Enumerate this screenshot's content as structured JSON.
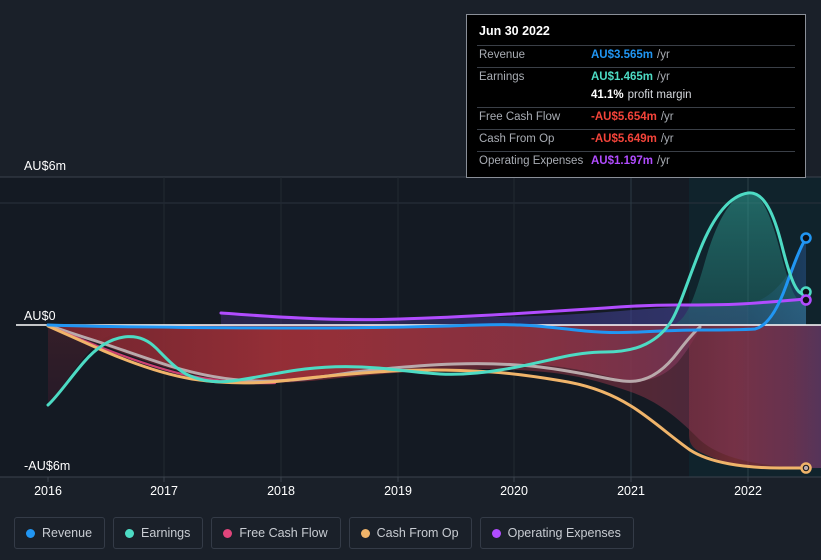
{
  "axes": {
    "y_labels": [
      "AU$6m",
      "AU$0",
      "-AU$6m"
    ],
    "x_labels": [
      "2016",
      "2017",
      "2018",
      "2019",
      "2020",
      "2021",
      "2022"
    ]
  },
  "tooltip": {
    "date": "Jun 30 2022",
    "rows": [
      {
        "label": "Revenue",
        "value": "AU$3.565m",
        "unit": "/yr",
        "color": "#2196f3"
      },
      {
        "label": "Earnings",
        "value": "AU$1.465m",
        "unit": "/yr",
        "color": "#4ddbc4"
      },
      {
        "label": "",
        "value": "41.1%",
        "unit": "",
        "note": "profit margin",
        "color": "#ffffff"
      },
      {
        "label": "Free Cash Flow",
        "value": "-AU$5.654m",
        "unit": "/yr",
        "color": "#f4443a"
      },
      {
        "label": "Cash From Op",
        "value": "-AU$5.649m",
        "unit": "/yr",
        "color": "#f4443a"
      },
      {
        "label": "Operating Expenses",
        "value": "AU$1.197m",
        "unit": "/yr",
        "color": "#b14cff"
      }
    ]
  },
  "legend": {
    "items": [
      {
        "label": "Revenue",
        "color": "#2196f3"
      },
      {
        "label": "Earnings",
        "color": "#4ddbc4"
      },
      {
        "label": "Free Cash Flow",
        "color": "#e0457b"
      },
      {
        "label": "Cash From Op",
        "color": "#f0b46a"
      },
      {
        "label": "Operating Expenses",
        "color": "#b14cff"
      }
    ]
  },
  "chart_data": {
    "type": "area",
    "title": "",
    "xlabel": "",
    "ylabel": "AU$",
    "ylim": [
      -6.6,
      6.6
    ],
    "xlim": [
      2015.7,
      2022.75
    ],
    "grid": true,
    "legend_position": "bottom-left",
    "zero_line": 0,
    "forecast_start_x": 2021.85,
    "currency": "AU$",
    "units": "millions",
    "x": [
      2015.75,
      2016.0,
      2016.3,
      2016.6,
      2017.0,
      2017.4,
      2017.8,
      2018.0,
      2018.4,
      2018.8,
      2019.0,
      2019.4,
      2019.8,
      2020.0,
      2020.4,
      2020.8,
      2021.0,
      2021.4,
      2021.85,
      2022.1,
      2022.45,
      2022.72
    ],
    "series": [
      {
        "name": "Revenue",
        "color": "#2196f3",
        "values": [
          0.0,
          0.0,
          -0.02,
          -0.04,
          -0.05,
          -0.05,
          -0.06,
          -0.06,
          -0.06,
          -0.06,
          -0.06,
          -0.05,
          -0.04,
          -0.02,
          0.02,
          0.0,
          -0.12,
          -0.15,
          -0.12,
          0.05,
          1.4,
          3.565
        ],
        "end_marker": true
      },
      {
        "name": "Earnings",
        "color": "#4ddbc4",
        "values": [
          -4.75,
          -3.6,
          -2.1,
          -1.25,
          -1.45,
          -1.8,
          -2.2,
          -2.35,
          -2.1,
          -1.85,
          -1.75,
          -1.8,
          -1.95,
          -1.9,
          -1.6,
          -1.4,
          -1.55,
          -1.05,
          1.1,
          4.3,
          5.55,
          1.465
        ],
        "end_marker": true
      },
      {
        "name": "Free Cash Flow",
        "color": "#e0457b",
        "values": [
          -0.1,
          -0.55,
          -0.95,
          -1.3,
          -1.55,
          -1.75,
          -1.95,
          -2.05,
          -1.85,
          -1.6,
          -1.5,
          -1.45,
          -1.4,
          -1.4,
          -1.45,
          -1.6,
          -1.75,
          -1.6,
          -1.05,
          -5.654,
          -5.654,
          -5.654
        ],
        "end_marker": true,
        "note": "plotted as muted grey-pink upper boundary of the negative red band"
      },
      {
        "name": "Cash From Op",
        "color": "#f0b46a",
        "values": [
          -0.1,
          -0.6,
          -1.05,
          -1.45,
          -1.75,
          -1.95,
          -2.2,
          -2.3,
          -2.1,
          -1.95,
          -1.95,
          -2.0,
          -2.1,
          -2.1,
          -2.15,
          -2.35,
          -2.6,
          -3.4,
          -4.6,
          -5.45,
          -5.62,
          -5.649
        ],
        "end_marker": true
      },
      {
        "name": "Operating Expenses",
        "color": "#b14cff",
        "values": [
          null,
          null,
          null,
          null,
          null,
          0.45,
          0.38,
          0.34,
          0.3,
          0.3,
          0.32,
          0.36,
          0.42,
          0.46,
          0.55,
          0.66,
          0.72,
          0.74,
          0.68,
          0.72,
          0.78,
          1.197
        ],
        "start_x": 2017.35,
        "end_marker": true
      }
    ]
  }
}
